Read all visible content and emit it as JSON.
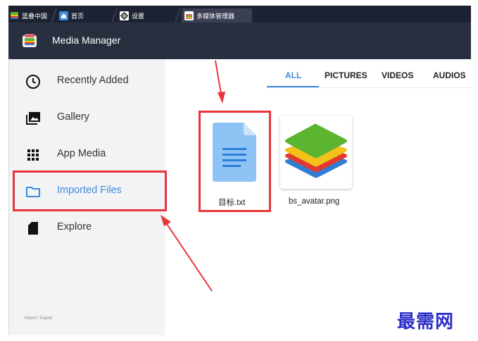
{
  "tabs": [
    {
      "label": "蓝叠中国",
      "icon": "bluestacks-logo-icon"
    },
    {
      "label": "首页",
      "icon": "home-icon"
    },
    {
      "label": "设置",
      "icon": "gear-icon"
    },
    {
      "label": "多媒体管理器",
      "icon": "media-manager-icon"
    }
  ],
  "header": {
    "title": "Media Manager"
  },
  "sidebar": {
    "items": [
      {
        "label": "Recently Added",
        "icon": "clock-icon"
      },
      {
        "label": "Gallery",
        "icon": "gallery-icon"
      },
      {
        "label": "App Media",
        "icon": "grid-icon"
      },
      {
        "label": "Imported Files",
        "icon": "folder-icon",
        "active": true
      },
      {
        "label": "Explore",
        "icon": "sd-card-icon"
      }
    ],
    "footer": "Import / Export"
  },
  "filter_tabs": [
    {
      "label": "ALL",
      "active": true
    },
    {
      "label": "PICTURES"
    },
    {
      "label": "VIDEOS"
    },
    {
      "label": "AUDIOS"
    }
  ],
  "files": [
    {
      "name": "目标.txt",
      "icon": "document-icon"
    },
    {
      "name": "bs_avatar.png",
      "icon": "bluestacks-stack-icon"
    }
  ],
  "watermark": "最需网",
  "colors": {
    "accent": "#3d8ae0",
    "annotation": "#e8343a",
    "header_bg": "#283040",
    "tabbar_bg": "#1d2233",
    "sidebar_bg": "#f2f3f5",
    "watermark": "#2c2fc8"
  }
}
